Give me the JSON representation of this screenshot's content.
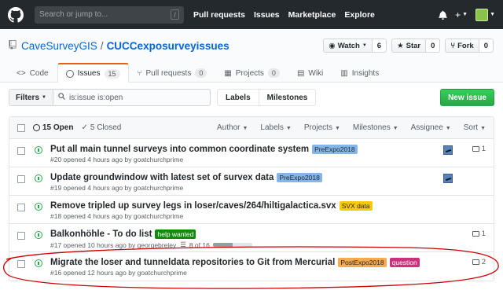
{
  "header": {
    "search_placeholder": "Search or jump to...",
    "search_key": "/",
    "nav": [
      "Pull requests",
      "Issues",
      "Marketplace",
      "Explore"
    ]
  },
  "repo": {
    "owner": "CaveSurveyGIS",
    "separator": "/",
    "name": "CUCCexposurveyissues",
    "watch": {
      "label": "Watch",
      "count": "6"
    },
    "star": {
      "label": "Star",
      "count": "0"
    },
    "fork": {
      "label": "Fork",
      "count": "0"
    }
  },
  "tabs": [
    {
      "label": "Code",
      "count": null
    },
    {
      "label": "Issues",
      "count": "15"
    },
    {
      "label": "Pull requests",
      "count": "0"
    },
    {
      "label": "Projects",
      "count": "0"
    },
    {
      "label": "Wiki",
      "count": null
    },
    {
      "label": "Insights",
      "count": null
    }
  ],
  "subnav": {
    "filters_label": "Filters",
    "query": "is:issue is:open",
    "labels_label": "Labels",
    "milestones_label": "Milestones",
    "new_issue_label": "New issue"
  },
  "box_header": {
    "open_label": "15 Open",
    "closed_label": "5 Closed",
    "sort_menus": [
      "Author",
      "Labels",
      "Projects",
      "Milestones",
      "Assignee",
      "Sort"
    ]
  },
  "colors": {
    "label_preexpo": "#84b6eb",
    "label_svx": "#fbca04",
    "label_help": "#128a0c",
    "label_postexpo": "#f9a94e",
    "label_question": "#cc317c",
    "highlight": "#cc0000"
  },
  "issues": [
    {
      "title": "Put all main tunnel surveys into common coordinate system",
      "labels": [
        {
          "text": "PreExpo2018",
          "key": "preexpo"
        }
      ],
      "meta": "#20 opened 4 hours ago by goatchurchprime",
      "comments": "1",
      "assignee": true,
      "progress": null
    },
    {
      "title": "Update groundwindow with latest set of survex data",
      "labels": [
        {
          "text": "PreExpo2018",
          "key": "preexpo"
        }
      ],
      "meta": "#19 opened 4 hours ago by goatchurchprime",
      "comments": null,
      "assignee": true,
      "progress": null
    },
    {
      "title": "Remove tripled up survey legs in loser/caves/264/hiltigalactica.svx",
      "labels": [
        {
          "text": "SVX data",
          "key": "svx"
        }
      ],
      "meta": "#18 opened 4 hours ago by goatchurchprime",
      "comments": null,
      "assignee": false,
      "progress": null
    },
    {
      "title": "Balkonhöhle - To do list",
      "labels": [
        {
          "text": "help wanted",
          "key": "help"
        }
      ],
      "meta": "#17 opened 10 hours ago by georgebreley",
      "comments": "1",
      "assignee": false,
      "progress": {
        "text": "8 of 16",
        "fraction": 0.5
      }
    },
    {
      "title": "Migrate the loser and tunneldata repositories to Git from Mercurial",
      "labels": [
        {
          "text": "PostExpo2018",
          "key": "postexpo"
        },
        {
          "text": "question",
          "key": "question"
        }
      ],
      "meta": "#16 opened 12 hours ago by goatchurchprime",
      "comments": "2",
      "assignee": false,
      "progress": null
    }
  ]
}
